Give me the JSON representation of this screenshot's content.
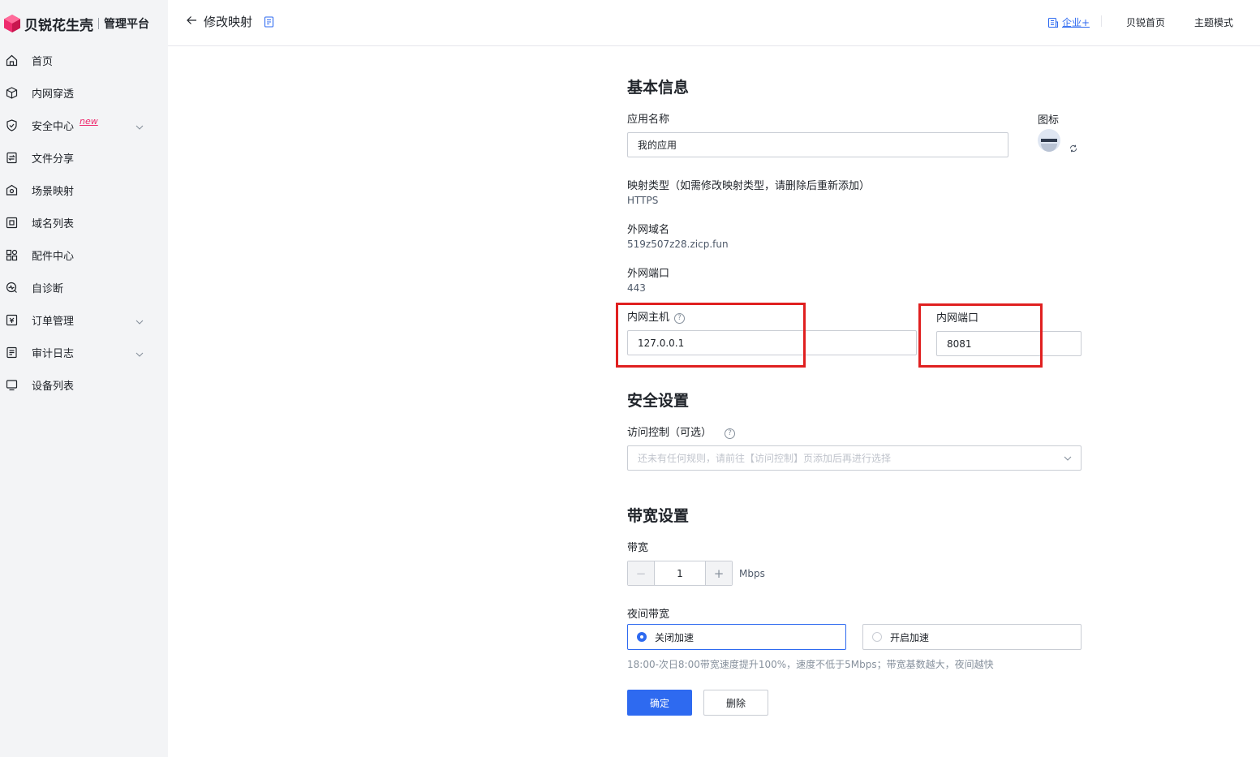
{
  "brand": {
    "name": "贝锐花生壳",
    "sub": "管理平台"
  },
  "sidebar": {
    "items": [
      {
        "label": "首页",
        "icon": "home-icon"
      },
      {
        "label": "内网穿透",
        "icon": "cube-icon"
      },
      {
        "label": "安全中心",
        "icon": "shield-icon",
        "badge": "new",
        "expandable": true
      },
      {
        "label": "文件分享",
        "icon": "file-share-icon"
      },
      {
        "label": "场景映射",
        "icon": "scene-icon"
      },
      {
        "label": "域名列表",
        "icon": "domain-icon"
      },
      {
        "label": "配件中心",
        "icon": "grid-icon"
      },
      {
        "label": "自诊断",
        "icon": "diagnose-icon"
      },
      {
        "label": "订单管理",
        "icon": "order-icon",
        "expandable": true
      },
      {
        "label": "审计日志",
        "icon": "log-icon",
        "expandable": true
      },
      {
        "label": "设备列表",
        "icon": "device-icon"
      }
    ]
  },
  "header": {
    "title": "修改映射",
    "enterprise": "企业+",
    "home_link": "贝锐首页",
    "theme_link": "主题模式"
  },
  "basic": {
    "section_title": "基本信息",
    "app_name_label": "应用名称",
    "app_name_value": "我的应用",
    "icon_label": "图标",
    "map_type_label": "映射类型（如需修改映射类型，请删除后重新添加）",
    "map_type_value": "HTTPS",
    "domain_label": "外网域名",
    "domain_value": "519z507z28.zicp.fun",
    "ext_port_label": "外网端口",
    "ext_port_value": "443",
    "host_label": "内网主机",
    "host_value": "127.0.0.1",
    "int_port_label": "内网端口",
    "int_port_value": "8081"
  },
  "security": {
    "section_title": "安全设置",
    "access_label": "访问控制（可选）",
    "access_placeholder": "还未有任何规则，请前往【访问控制】页添加后再进行选择"
  },
  "bandwidth": {
    "section_title": "带宽设置",
    "bw_label": "带宽",
    "bw_value": "1",
    "bw_unit": "Mbps",
    "night_label": "夜间带宽",
    "opt_off": "关闭加速",
    "opt_on": "开启加速",
    "selected": "关闭加速",
    "hint": "18:00-次日8:00带宽速度提升100%，速度不低于5Mbps；带宽基数越大，夜间越快"
  },
  "actions": {
    "confirm": "确定",
    "delete": "删除"
  },
  "colors": {
    "accent": "#2e6af0",
    "highlight": "#e02020",
    "brand": "#ee2b6e"
  }
}
